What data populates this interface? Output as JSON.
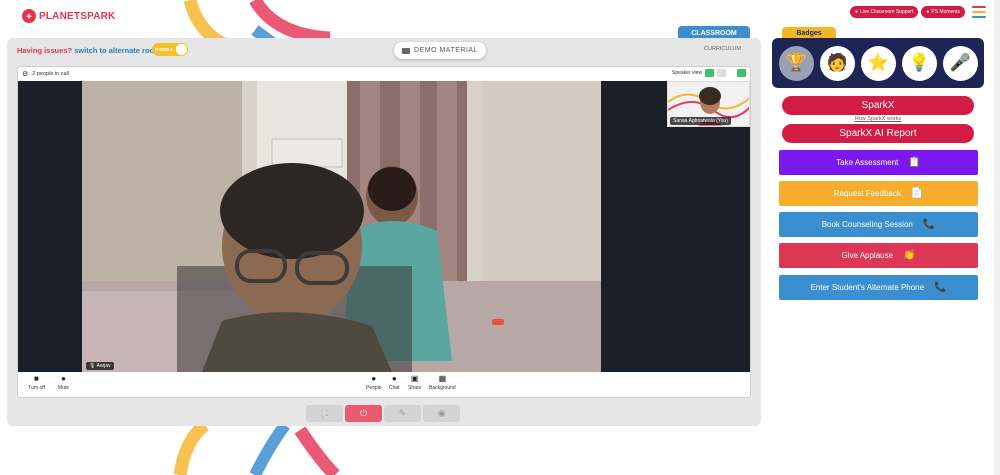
{
  "header": {
    "logo_text": "PLANETSPARK",
    "support_label": "Live Classroom Support",
    "moments_label": "PS Moments"
  },
  "classroom": {
    "issues_text": "Having issues? ",
    "alternate_text": "switch to alternate room",
    "room_toggle_label": "ROOM 2",
    "demo_material_label": "DEMO MATERIAL",
    "classroom_tab_label": "CLASSROOM",
    "curriculum_label": "CURRICULUM"
  },
  "meet": {
    "people_count_text": "2 people in call",
    "speaker_view_label": "Speaker view",
    "main_participant_name": "Aarjav",
    "self_participant_name": "Sanaa Agboatwala (You)",
    "controls": {
      "camera_label": "Turn off",
      "mic_label": "Mute",
      "people_label": "People",
      "chat_label": "Chat",
      "share_label": "Share",
      "background_label": "Background"
    }
  },
  "sidebar": {
    "badges_label": "Badges",
    "sparkx_label": "SparkX",
    "how_sparkx_label": "How SparkX works",
    "sparkx_report_label": "SparkX AI Report",
    "actions": [
      {
        "label": "Take Assessment",
        "color": "#7b17ef",
        "icon": "clipboard-icon"
      },
      {
        "label": "Request Feedback",
        "color": "#f7ad2d",
        "icon": "document-icon"
      },
      {
        "label": "Book Counseling Session",
        "color": "#3b8fd0",
        "icon": "phone-icon"
      },
      {
        "label": "Give Applause",
        "color": "#de3756",
        "icon": "clap-icon"
      },
      {
        "label": "Enter Student's Alternate Phone",
        "color": "#3b8fd0",
        "icon": "phone-icon"
      }
    ]
  },
  "colors": {
    "brand_red": "#d21c46",
    "navy": "#1e2454",
    "yellow": "#f2b824",
    "blue": "#3b8fd0"
  }
}
